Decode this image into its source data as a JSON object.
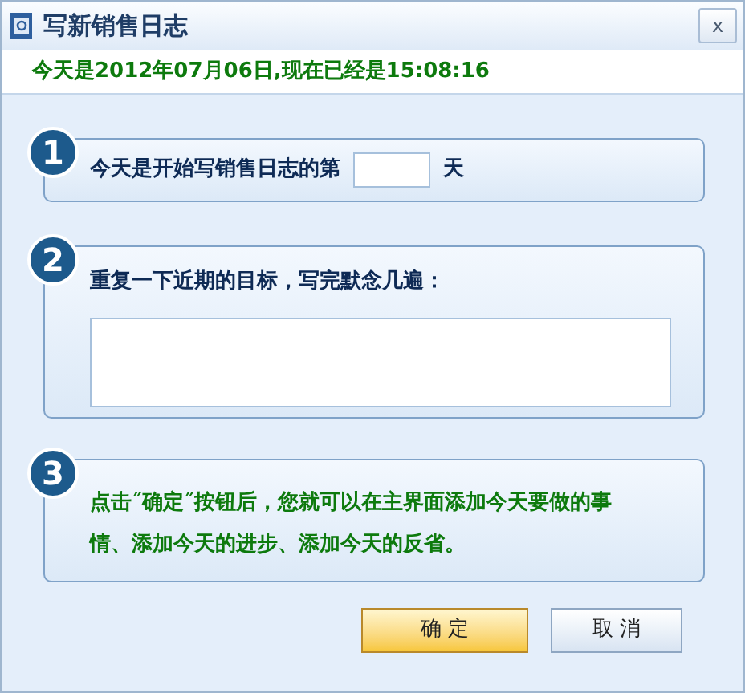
{
  "window": {
    "title": "写新销售日志",
    "close": "x"
  },
  "status": "今天是2012年07月06日,现在已经是15:08:16",
  "steps": [
    {
      "kind": "day_field",
      "number": "1",
      "label": "今天是开始写销售日志的第",
      "suffix": "天"
    },
    {
      "kind": "textarea",
      "number": "2",
      "label": "重复一下近期的目标，写完默念几遍："
    },
    {
      "kind": "note",
      "number": "3",
      "label": "点击˝确定˝按钮后，您就可以在主界面添加今天要做的事情、添加今天的进步、添加今天的反省。"
    }
  ],
  "buttons": [
    {
      "label": "确 定",
      "default": true
    },
    {
      "label": "取 消",
      "default": false
    }
  ]
}
